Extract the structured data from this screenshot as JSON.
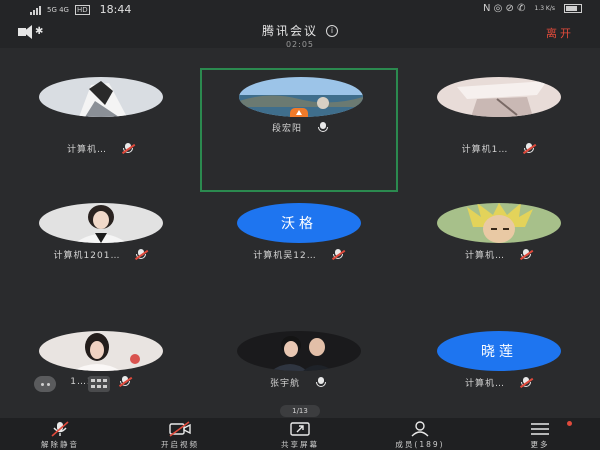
{
  "status_bar": {
    "carrier_left": "5G 4G",
    "hd_badge": "HD",
    "time": "18:44",
    "right_icons": "N ◎ ⊘ ✆",
    "net_speed": "1.3 K/s"
  },
  "header": {
    "title": "腾讯会议",
    "info_symbol": "i",
    "timer": "02:05",
    "leave_label": "离开"
  },
  "participants": [
    {
      "name": "计算机…",
      "avatar": "photo",
      "muted": true
    },
    {
      "name": "段宏阳",
      "avatar": "photo",
      "muted": false,
      "active": true
    },
    {
      "name": "计算机1…",
      "avatar": "photo",
      "muted": true
    },
    {
      "name": "计算机1201…",
      "avatar": "photo",
      "muted": true
    },
    {
      "name": "计算机吴12…",
      "avatar": "text",
      "avatar_text": "沃格",
      "muted": true
    },
    {
      "name": "计算机…",
      "avatar": "photo",
      "muted": true
    },
    {
      "name": "1…3…",
      "avatar": "photo",
      "muted": true
    },
    {
      "name": "张宇航",
      "avatar": "photo",
      "muted": false
    },
    {
      "name": "计算机…",
      "avatar": "text",
      "avatar_text": "晓莲",
      "muted": true
    }
  ],
  "page_indicator": "1/13",
  "toolbar": {
    "mute_label": "解除静音",
    "video_label": "开启视频",
    "share_label": "共享屏幕",
    "members_label": "成员(189)",
    "more_label": "更多"
  },
  "colors": {
    "accent_blue": "#1e75f0",
    "leave_red": "#e24b3b",
    "active_border": "#2b8a4f",
    "speaking_orange": "#ef7a2a"
  }
}
